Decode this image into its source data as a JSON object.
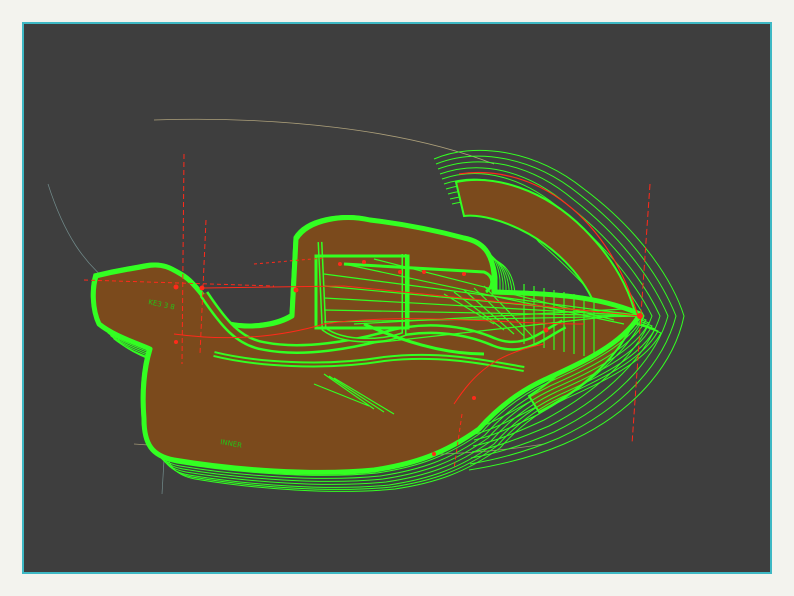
{
  "canvas": {
    "background": "#3e3e3e",
    "frame_color": "#3eb8c4",
    "page_background": "#f3f3ee"
  },
  "palette": {
    "outline": "#33ff22",
    "fill": "#7b4a1c",
    "centerline": "#ff2a1a",
    "guide": "#c9b98a"
  },
  "labels": {
    "part_label": "KE3 3 8",
    "inner_label": "INNER"
  }
}
